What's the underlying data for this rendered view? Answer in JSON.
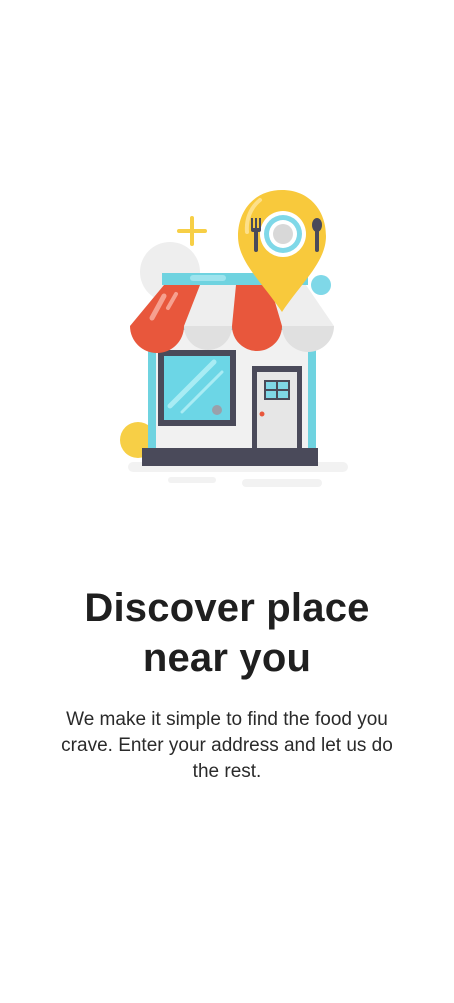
{
  "onboarding": {
    "title_line1": "Discover place",
    "title_line2": "near you",
    "description": "We make it simple to find the food you crave. Enter your address and let us do the rest."
  },
  "illustration": {
    "icon": "store-with-location-pin-icon",
    "colors": {
      "awning_red": "#e8573c",
      "awning_white": "#eeeeee",
      "wall_blue": "#6fd3e0",
      "window_blue": "#6cd6e6",
      "pin_yellow": "#f8c93c",
      "base_dark": "#4a4a5a",
      "sparkle_yellow": "#f7cf46",
      "dot_blue": "#7fd8e8",
      "circle_gray": "#eeeeee"
    }
  }
}
